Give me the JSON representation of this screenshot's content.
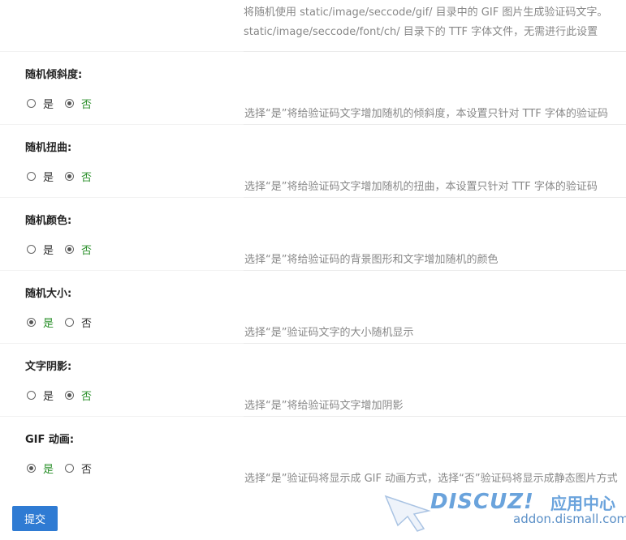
{
  "top_desc": {
    "line1": "将随机使用 static/image/seccode/gif/ 目录中的 GIF 图片生成验证码文字。",
    "line2": "static/image/seccode/font/ch/ 目录下的 TTF 字体文件，无需进行此设置"
  },
  "settings": [
    {
      "title": "随机倾斜度:",
      "yes": "是",
      "no": "否",
      "selected": "no",
      "desc": "选择“是”将给验证码文字增加随机的倾斜度，本设置只针对 TTF 字体的验证码"
    },
    {
      "title": "随机扭曲:",
      "yes": "是",
      "no": "否",
      "selected": "no",
      "desc": "选择“是”将给验证码文字增加随机的扭曲，本设置只针对 TTF 字体的验证码"
    },
    {
      "title": "随机颜色:",
      "yes": "是",
      "no": "否",
      "selected": "no",
      "desc": "选择“是”将给验证码的背景图形和文字增加随机的颜色"
    },
    {
      "title": "随机大小:",
      "yes": "是",
      "no": "否",
      "selected": "yes",
      "desc": "选择“是”验证码文字的大小随机显示"
    },
    {
      "title": "文字阴影:",
      "yes": "是",
      "no": "否",
      "selected": "no",
      "desc": "选择“是”将给验证码文字增加阴影"
    },
    {
      "title": "GIF 动画:",
      "yes": "是",
      "no": "否",
      "selected": "yes",
      "desc": "选择“是”验证码将显示成 GIF 动画方式，选择“否”验证码将显示成静态图片方式"
    }
  ],
  "submit_label": "提交",
  "watermark": {
    "brand": "DISCUZ!",
    "cn": "应用中心",
    "url": "addon.dismall.com"
  },
  "colors": {
    "accent": "#2f7bd3",
    "selected_label": "#2a8f2a",
    "desc_text": "#888888"
  }
}
